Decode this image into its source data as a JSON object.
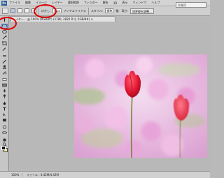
{
  "menubar": {
    "app_logo": "Ps",
    "items": [
      "ファイル",
      "編集",
      "イメージ",
      "レイヤー",
      "選択範囲",
      "フィルター",
      "解析",
      "3D",
      "表示",
      "ウィンドウ",
      "ヘルプ"
    ]
  },
  "options": {
    "feather_label": "ぼかし:",
    "feather_value": "0 px",
    "antialias_label": "アンチエイリアス",
    "style_label": "スタイル:",
    "style_value": "標準",
    "width_label": "幅:",
    "height_label": "高さ:",
    "refine_button": "境界線を調整...",
    "workspace_field": "作業用"
  },
  "document": {
    "tab_label": "レイヤー... @ 100% (RGB/8*) (3780, 2820 Rゴ, RGB/8#) ×",
    "close_glyph": "×"
  },
  "status": {
    "zoom": "100%",
    "doc_info": "ファイル : 4.42M/4.42M"
  },
  "colors": {
    "annotation": "#e00000",
    "selected_tool": "#9eb8de"
  },
  "tools": [
    "move-tool",
    "marquee-tool",
    "lasso-tool",
    "quick-select-tool",
    "crop-tool",
    "eyedropper-tool",
    "healing-tool",
    "brush-tool",
    "clone-stamp-tool",
    "history-brush-tool",
    "eraser-tool",
    "gradient-tool",
    "blur-tool",
    "dodge-tool",
    "pen-tool",
    "type-tool",
    "path-select-tool",
    "shape-tool",
    "3d-rotate-tool",
    "3d-orbit-tool",
    "hand-tool",
    "zoom-tool"
  ]
}
